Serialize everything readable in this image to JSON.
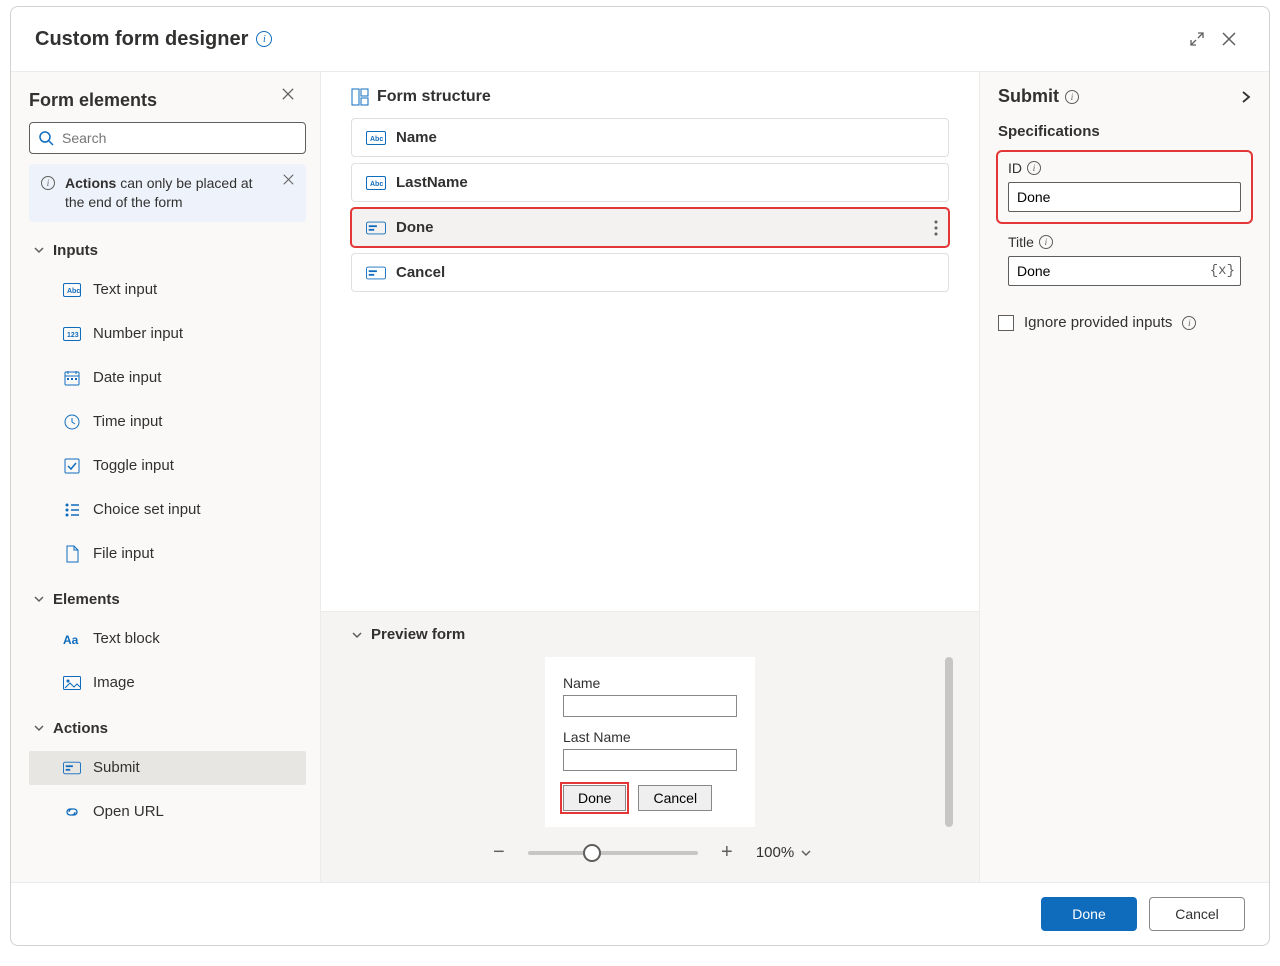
{
  "header": {
    "title": "Custom form designer"
  },
  "left": {
    "title": "Form elements",
    "search_placeholder": "Search",
    "notice_prefix_bold": "Actions",
    "notice_rest": " can only be placed at the end of the form",
    "sections": {
      "inputs": {
        "label": "Inputs",
        "items": [
          "Text input",
          "Number input",
          "Date input",
          "Time input",
          "Toggle input",
          "Choice set input",
          "File input"
        ]
      },
      "elements": {
        "label": "Elements",
        "items": [
          "Text block",
          "Image"
        ]
      },
      "actions": {
        "label": "Actions",
        "items": [
          "Submit",
          "Open URL"
        ],
        "selected_index": 0
      }
    }
  },
  "center": {
    "structure_title": "Form structure",
    "rows": [
      {
        "icon": "abc",
        "label": "Name"
      },
      {
        "icon": "abc",
        "label": "LastName"
      },
      {
        "icon": "submit",
        "label": "Done",
        "selected": true
      },
      {
        "icon": "submit",
        "label": "Cancel"
      }
    ],
    "preview_title": "Preview form",
    "preview": {
      "name_label": "Name",
      "lastname_label": "Last Name",
      "done_btn": "Done",
      "cancel_btn": "Cancel"
    },
    "zoom_value": "100%"
  },
  "right": {
    "title": "Submit",
    "spec_title": "Specifications",
    "id": {
      "label": "ID",
      "value": "Done"
    },
    "title_field": {
      "label": "Title",
      "value": "Done",
      "token": "{x}"
    },
    "ignore_label": "Ignore provided inputs"
  },
  "footer": {
    "done": "Done",
    "cancel": "Cancel"
  }
}
